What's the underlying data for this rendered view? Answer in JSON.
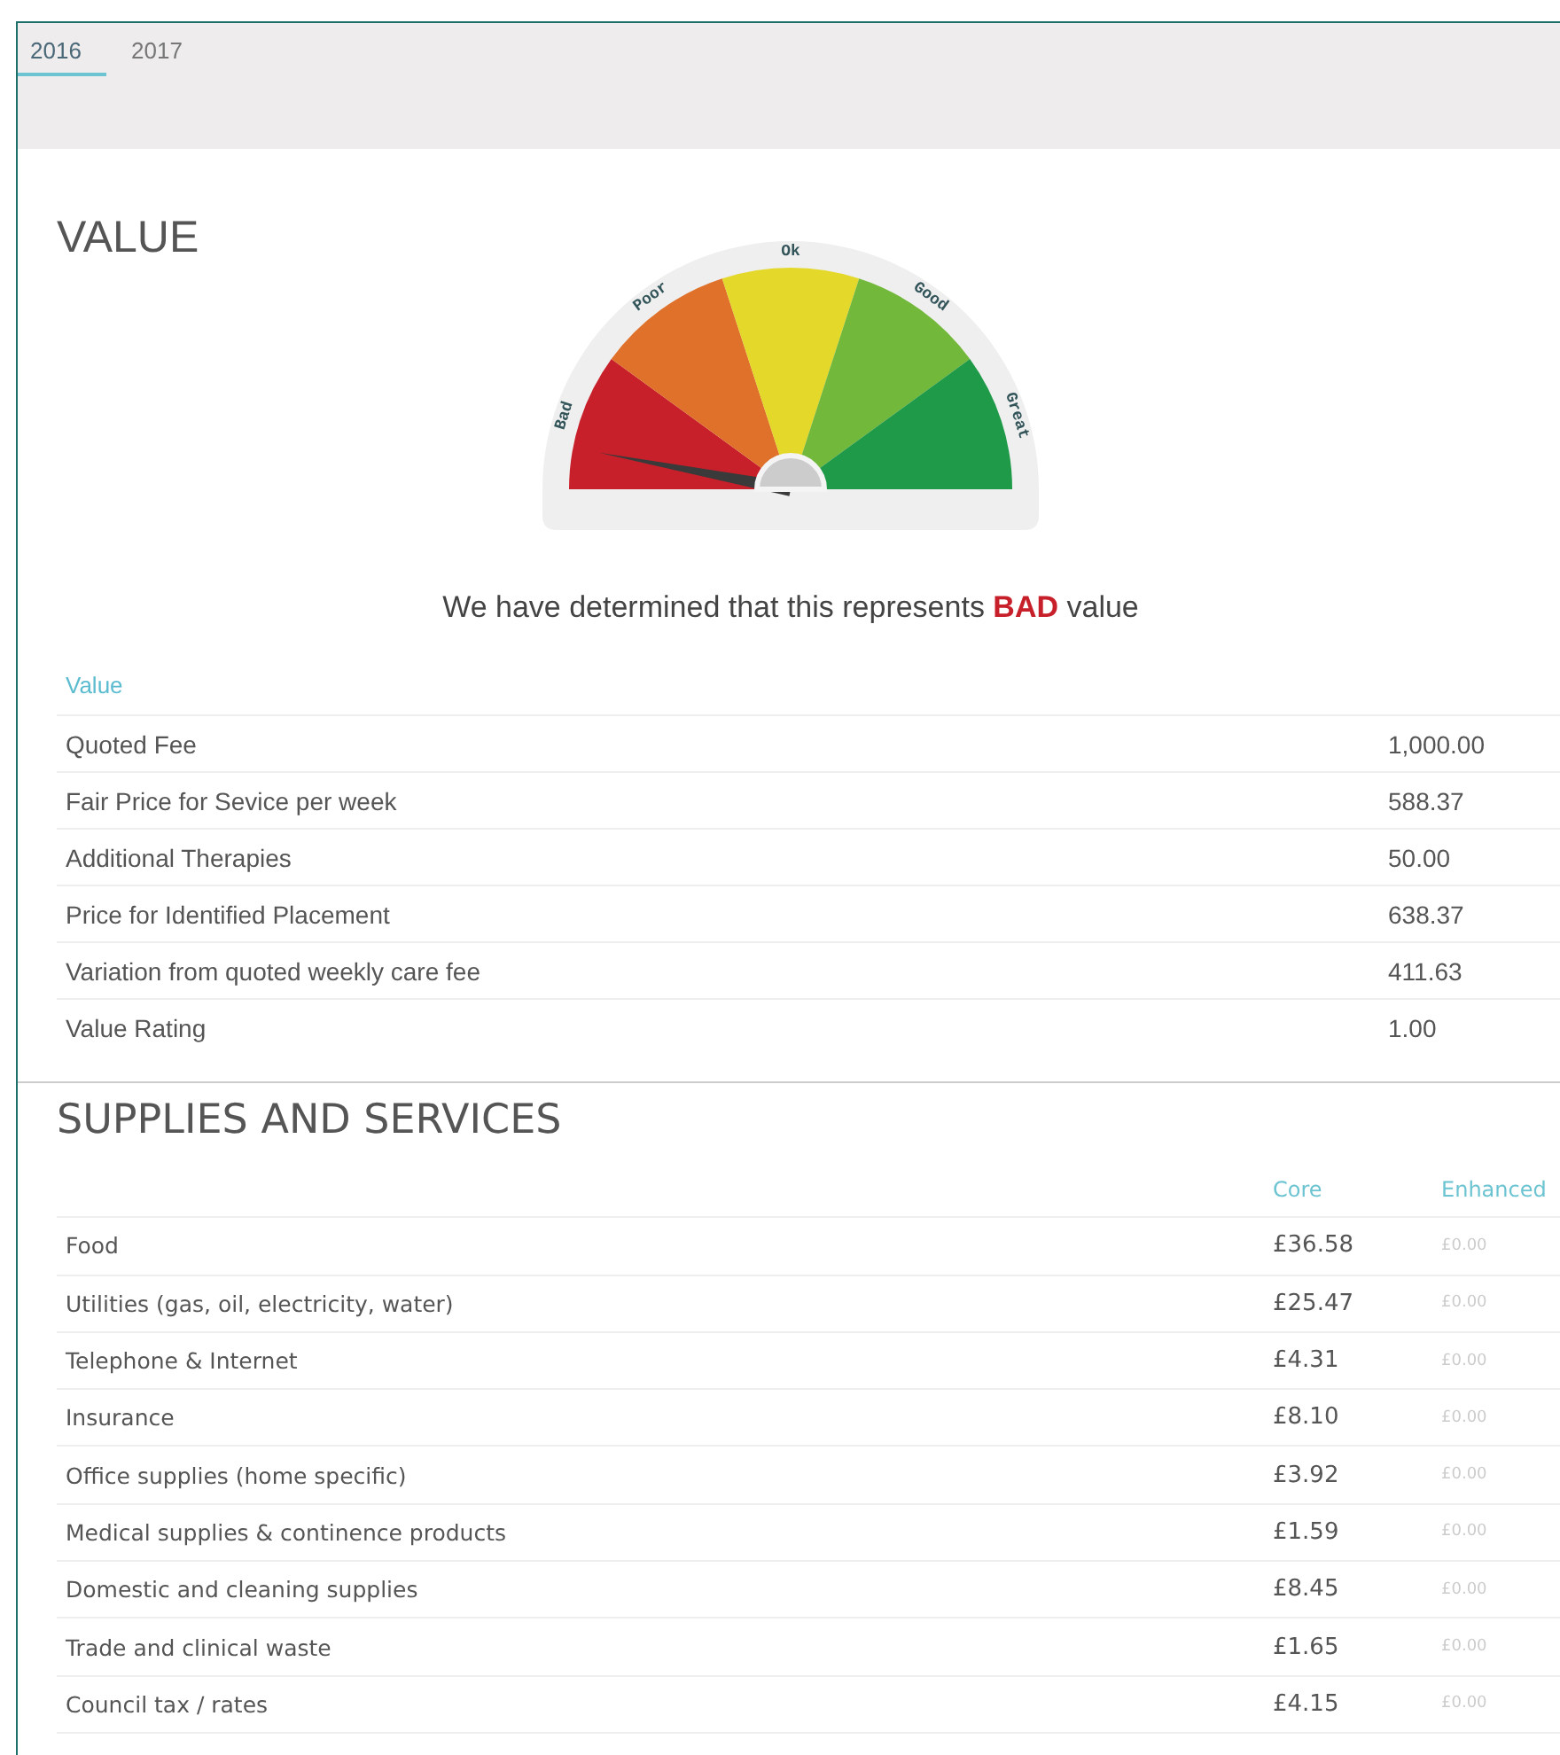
{
  "tabs": [
    {
      "label": "2016",
      "selected": true
    },
    {
      "label": "2017",
      "selected": false
    }
  ],
  "value_section": {
    "title": "VALUE",
    "gauge": {
      "segments": [
        {
          "label": "Bad",
          "color": "#c8202a",
          "pointed": true
        },
        {
          "label": "Poor",
          "color": "#e0712a",
          "pointed": false
        },
        {
          "label": "Ok",
          "color": "#e4d82a",
          "pointed": false
        },
        {
          "label": "Good",
          "color": "#72b83a",
          "pointed": false
        },
        {
          "label": "Great",
          "color": "#1e9a48",
          "pointed": false
        }
      ]
    },
    "verdict": "We have determined that this represents **BAD** value",
    "table": {
      "heading": "Value",
      "rows": [
        {
          "label": "Quoted Fee",
          "value": "1,000.00"
        },
        {
          "label": "Fair Price for Sevice per week",
          "value": "588.37"
        },
        {
          "label": "Additional Therapies",
          "value": "50.00"
        },
        {
          "label": "Price for Identified Placement",
          "value": "638.37"
        },
        {
          "label": "Variation from quoted weekly care fee",
          "value": "411.63"
        },
        {
          "label": "Value Rating",
          "value": "1.00"
        }
      ]
    }
  },
  "supplies_section": {
    "title": "SUPPLIES AND SERVICES",
    "columns": [
      "Core",
      "Enhanced"
    ],
    "rows": [
      {
        "label": "Food",
        "core": "£36.58",
        "enhanced": "£0.00"
      },
      {
        "label": "Utilities (gas, oil, electricity, water)",
        "core": "£25.47",
        "enhanced": "£0.00"
      },
      {
        "label": "Telephone & Internet",
        "core": "£4.31",
        "enhanced": "£0.00"
      },
      {
        "label": "Insurance",
        "core": "£8.10",
        "enhanced": "£0.00"
      },
      {
        "label": "Office supplies (home specific)",
        "core": "£3.92",
        "enhanced": "£0.00"
      },
      {
        "label": "Medical supplies & continence products",
        "core": "£1.59",
        "enhanced": "£0.00"
      },
      {
        "label": "Domestic and cleaning supplies",
        "core": "£8.45",
        "enhanced": "£0.00"
      },
      {
        "label": "Trade and clinical waste",
        "core": "£1.65",
        "enhanced": "£0.00"
      },
      {
        "label": "Council tax / rates",
        "core": "£4.15",
        "enhanced": "£0.00"
      }
    ]
  }
}
